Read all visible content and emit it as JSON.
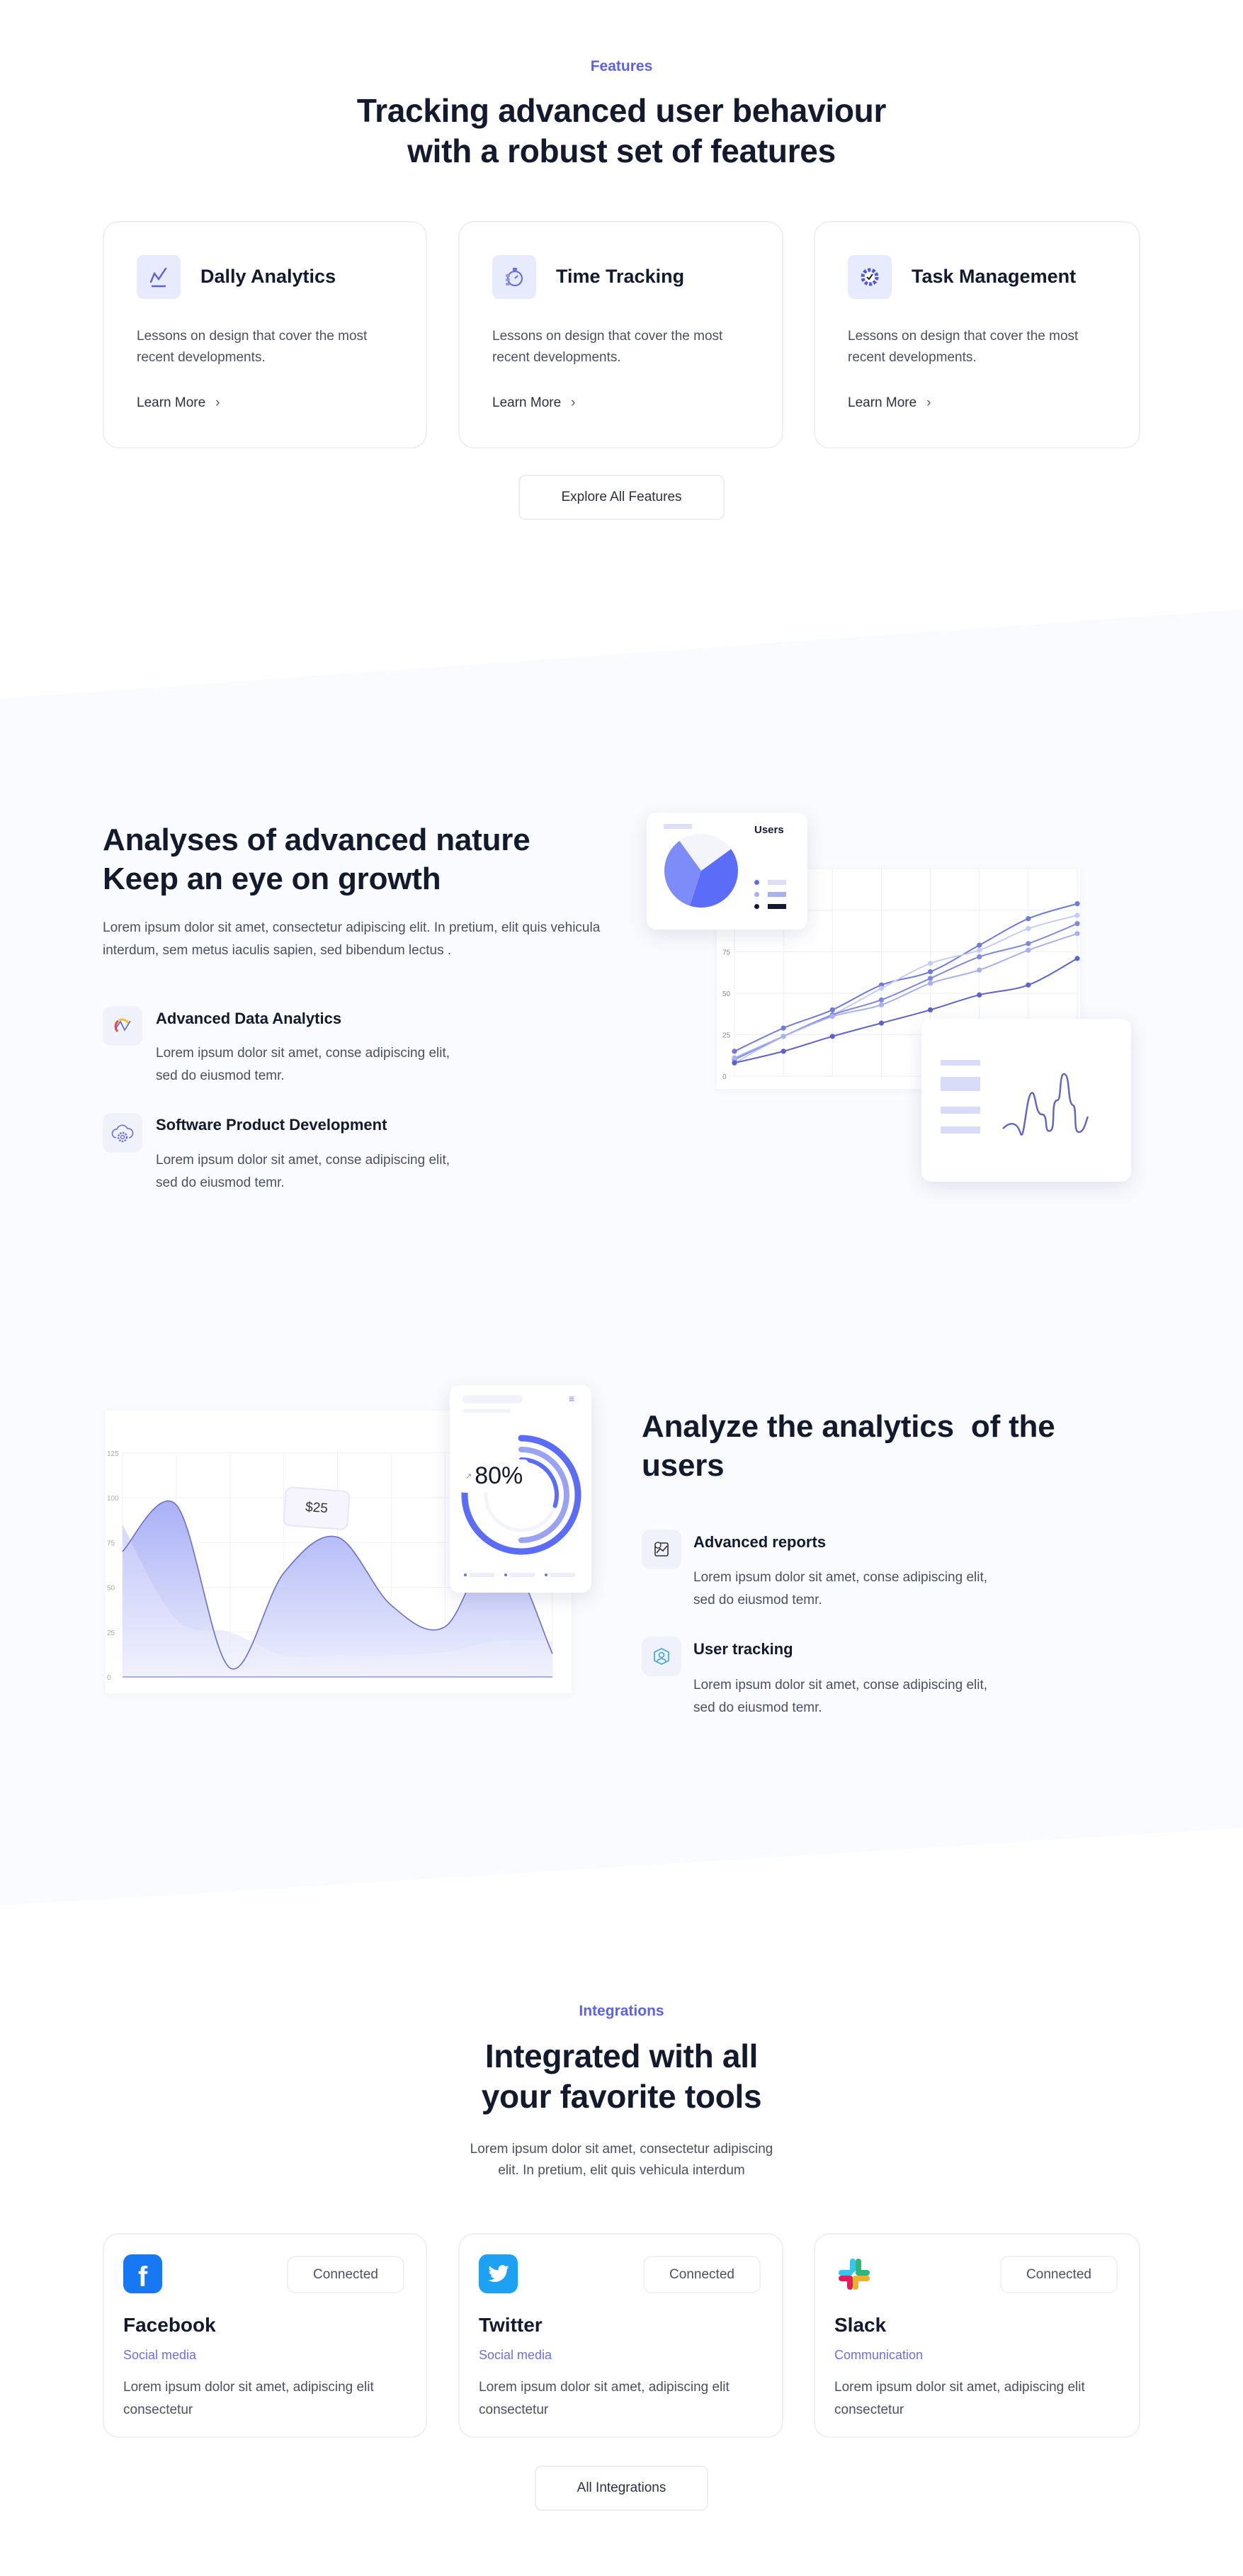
{
  "features": {
    "eyebrow": "Features",
    "title_line1": "Tracking advanced user behaviour",
    "title_line2": "with a robust set of features",
    "cards": [
      {
        "title": "Dally Analytics",
        "icon": "chart-line-icon",
        "desc": "Lessons on design that cover the most recent developments.",
        "link": "Learn More"
      },
      {
        "title": "Time Tracking",
        "icon": "stopwatch-icon",
        "desc": "Lessons on design that cover the most recent developments.",
        "link": "Learn More"
      },
      {
        "title": "Task Management",
        "icon": "gear-check-icon",
        "desc": "Lessons on design that cover the most recent developments.",
        "link": "Learn More"
      }
    ],
    "button": "Explore All Features"
  },
  "growth": {
    "title_line1": "Analyses of advanced nature",
    "title_line2": "Keep an eye on growth",
    "paragraph": "Lorem ipsum dolor sit amet, consectetur adipiscing elit. In pretium, elit quis vehicula interdum, sem metus iaculis sapien, sed bibendum lectus .",
    "items": [
      {
        "title": "Advanced Data Analytics",
        "icon": "analytics-icon",
        "desc": "Lorem ipsum dolor sit amet, conse adipiscing elit, sed do eiusmod temr."
      },
      {
        "title": "Software Product Development",
        "icon": "cloud-gear-icon",
        "desc": "Lorem ipsum dolor sit amet, conse adipiscing elit, sed do eiusmod temr."
      }
    ],
    "pie_card": {
      "title": "Users",
      "slices": [
        40,
        35,
        25
      ],
      "colors": [
        "#5a6cf8",
        "#7d8cf9",
        "#f4f5fb"
      ]
    },
    "line_chart": {
      "y_ticks": [
        "0",
        "25",
        "50",
        "75"
      ],
      "series": [
        {
          "color": "#6f79dc",
          "values": [
            15,
            29,
            40,
            55,
            63,
            79,
            95,
            104
          ]
        },
        {
          "color": "#c6cbf3",
          "values": [
            8,
            24,
            37,
            53,
            68,
            76,
            89,
            97
          ]
        },
        {
          "color": "#7e87e2",
          "values": [
            10,
            24,
            37,
            46,
            59,
            72,
            80,
            92
          ]
        },
        {
          "color": "#a9b0ee",
          "values": [
            11,
            24,
            36,
            43,
            56,
            64,
            76,
            86
          ]
        },
        {
          "color": "#5c63c9",
          "values": [
            8,
            15,
            24,
            32,
            40,
            49,
            55,
            71
          ]
        }
      ]
    }
  },
  "analyze": {
    "title_line1": "Analyze the analytics  of the",
    "title_line2": "users",
    "items": [
      {
        "title": "Advanced reports",
        "icon": "report-icon",
        "desc": "Lorem ipsum dolor sit amet, conse adipiscing elit, sed do eiusmod temr."
      },
      {
        "title": "User tracking",
        "icon": "user-tracking-icon",
        "desc": "Lorem ipsum dolor sit amet, conse adipiscing elit, sed do eiusmod temr."
      }
    ],
    "area_chart": {
      "y_ticks": [
        "0",
        "25",
        "50",
        "75",
        "100",
        "125"
      ],
      "main": [
        70,
        96,
        5,
        58,
        78,
        40,
        28,
        75,
        13
      ],
      "secondary": [
        85,
        32,
        25,
        12,
        12,
        12,
        14,
        20,
        20
      ],
      "tooltip": "$25"
    },
    "progress": {
      "value_label": "80%",
      "rings": [
        0.8,
        0.5,
        0.3
      ]
    }
  },
  "integrations": {
    "eyebrow": "Integrations",
    "title_line1": "Integrated with all",
    "title_line2": "your favorite tools",
    "paragraph_line1": "Lorem ipsum dolor sit amet, consectetur adipiscing",
    "paragraph_line2": "elit. In pretium, elit quis vehicula interdum",
    "cards": [
      {
        "name": "Facebook",
        "category": "Social media",
        "status": "Connected",
        "desc": "Lorem ipsum dolor sit amet, adipiscing elit consectetur",
        "icon": "facebook-icon",
        "color": "#1877f2"
      },
      {
        "name": "Twitter",
        "category": "Social media",
        "status": "Connected",
        "desc": "Lorem ipsum dolor sit amet, adipiscing elit consectetur",
        "icon": "twitter-icon",
        "color": "#1da1f2"
      },
      {
        "name": "Slack",
        "category": "Communication",
        "status": "Connected",
        "desc": "Lorem ipsum dolor sit amet, adipiscing elit consectetur",
        "icon": "slack-icon",
        "color": "#ffffff"
      }
    ],
    "button": "All Integrations"
  }
}
